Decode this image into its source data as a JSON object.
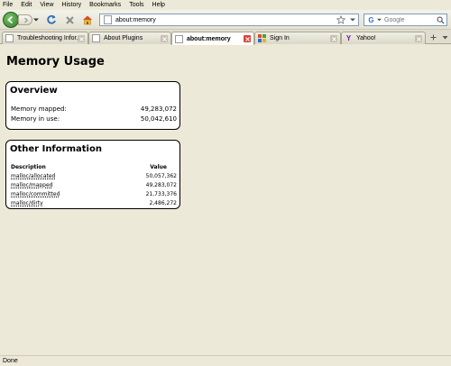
{
  "menu": [
    "File",
    "Edit",
    "View",
    "History",
    "Bookmarks",
    "Tools",
    "Help"
  ],
  "navbar": {
    "url": "about:memory",
    "search_placeholder": "Google",
    "search_engine_icon": "google-icon"
  },
  "tabs": [
    {
      "label": "Troubleshooting Infor...",
      "active": false,
      "icon": "page-icon"
    },
    {
      "label": "About Plugins",
      "active": false,
      "icon": "page-icon"
    },
    {
      "label": "about:memory",
      "active": true,
      "icon": "page-icon"
    },
    {
      "label": "Sign In",
      "active": false,
      "icon": "msn-icon"
    },
    {
      "label": "Yahoo!",
      "active": false,
      "icon": "yahoo-icon"
    }
  ],
  "page": {
    "title": "Memory Usage",
    "overview": {
      "heading": "Overview",
      "rows": [
        {
          "label": "Memory mapped:",
          "value": "49,283,072"
        },
        {
          "label": "Memory in use:",
          "value": "50,042,610"
        }
      ]
    },
    "other": {
      "heading": "Other Information",
      "col_description": "Description",
      "col_value": "Value",
      "rows": [
        {
          "description": "malloc/allocated",
          "value": "50,057,362"
        },
        {
          "description": "malloc/mapped",
          "value": "49,283,072"
        },
        {
          "description": "malloc/committed",
          "value": "21,733,376"
        },
        {
          "description": "malloc/dirty",
          "value": "2,486,272"
        }
      ]
    }
  },
  "status": "Done",
  "colors": {
    "chrome_bg": "#ece9d8",
    "back_button": "#3f9a35",
    "active_close": "#d9453a"
  }
}
